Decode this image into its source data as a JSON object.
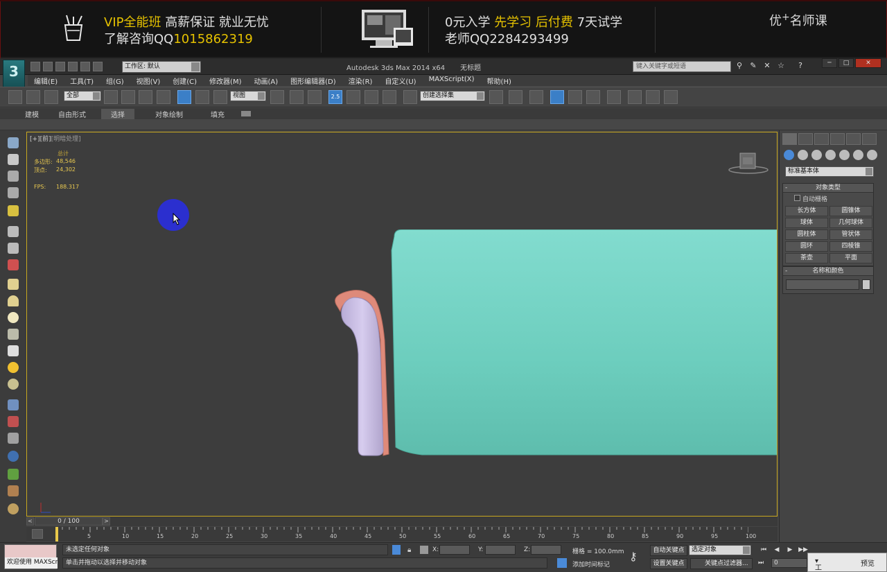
{
  "banner": {
    "vip_prefix": "VIP全能班",
    "vip_rest": " 高薪保证 就业无忧",
    "consult_prefix": "了解咨询QQ",
    "consult_qq": "1015862319",
    "promo_part1": "0元入学",
    "promo_part2": "先学习",
    "promo_part3": "后付费",
    "promo_part4": "7天试学",
    "teacher": "老师QQ2284293499",
    "brand_prefix": "优",
    "brand_plus": "+",
    "brand_suffix": "名师课"
  },
  "app": {
    "workspace_label": "工作区: 默认",
    "title": "Autodesk 3ds Max  2014 x64",
    "file_name": "无标题",
    "search_placeholder": "键入关键字或短语",
    "menus": [
      "编辑(E)",
      "工具(T)",
      "组(G)",
      "视图(V)",
      "创建(C)",
      "修改器(M)",
      "动画(A)",
      "图形编辑器(D)",
      "渲染(R)",
      "自定义(U)",
      "MAXScript(X)",
      "帮助(H)"
    ]
  },
  "toolbar": {
    "filter_value": "全部",
    "ref_coord": "视图",
    "snap_value": "2.5",
    "named_selection": "创建选择集"
  },
  "ribbon": {
    "tabs": [
      "建模",
      "自由形式",
      "选择",
      "对象绘制",
      "填充"
    ],
    "active_tab": "选择"
  },
  "viewport": {
    "label_plus": "[+]",
    "label_view": "[前]",
    "label_shading": "[明暗处理]",
    "stats_total": "总计",
    "stats_polys_label": "多边形:",
    "stats_polys": "48,546",
    "stats_verts_label": "顶点:",
    "stats_verts": "24,302",
    "fps_label": "FPS:",
    "fps": "188.317",
    "colors": {
      "sofa": "#79d4c6",
      "arm": "#c9bfe3",
      "trim": "#e08878",
      "background": "#3d3d3d",
      "border": "#c8a820"
    }
  },
  "command_panel": {
    "dropdown": "标准基本体",
    "object_type_title": "对象类型",
    "autogrid": "自动栅格",
    "objects": [
      "长方体",
      "圆锥体",
      "球体",
      "几何球体",
      "圆柱体",
      "管状体",
      "圆环",
      "四棱锥",
      "茶壶",
      "平面"
    ],
    "name_color_title": "名称和颜色"
  },
  "timeline": {
    "frame_indicator": "0 / 100",
    "ticks": [
      "5",
      "10",
      "15",
      "20",
      "25",
      "30",
      "35",
      "40",
      "45",
      "50",
      "55",
      "60",
      "65",
      "70",
      "75",
      "80",
      "85",
      "90",
      "95",
      "100"
    ]
  },
  "status": {
    "maxscript_welcome": "欢迎使用 MAXScr",
    "line1": "未选定任何对象",
    "line2": "单击并拖动以选择并移动对象",
    "x_label": "X:",
    "y_label": "Y:",
    "z_label": "Z:",
    "grid": "栅格 = 100.0mm",
    "add_time_tag": "添加时间标记",
    "auto_key": "自动关键点",
    "set_key": "设置关键点",
    "selected_object": "选定对象",
    "key_filters": "关键点过滤器...",
    "frame_value": "0",
    "popup_tools": "工具",
    "popup_preview": "预览"
  }
}
